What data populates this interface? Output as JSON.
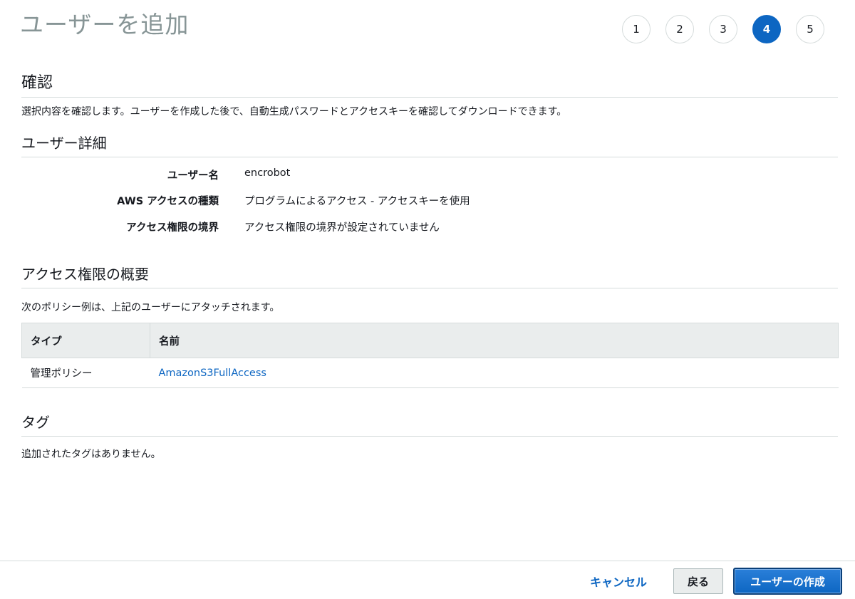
{
  "page": {
    "title": "ユーザーを追加"
  },
  "steps": [
    {
      "label": "1",
      "active": false
    },
    {
      "label": "2",
      "active": false
    },
    {
      "label": "3",
      "active": false
    },
    {
      "label": "4",
      "active": true
    },
    {
      "label": "5",
      "active": false
    }
  ],
  "review": {
    "heading": "確認",
    "description": "選択内容を確認します。ユーザーを作成した後で、自動生成パスワードとアクセスキーを確認してダウンロードできます。"
  },
  "user_details": {
    "heading": "ユーザー詳細",
    "rows": [
      {
        "label": "ユーザー名",
        "value": "encrobot"
      },
      {
        "label": "AWS アクセスの種類",
        "value": "プログラムによるアクセス - アクセスキーを使用"
      },
      {
        "label": "アクセス権限の境界",
        "value": "アクセス権限の境界が設定されていません"
      }
    ]
  },
  "permissions": {
    "heading": "アクセス権限の概要",
    "description": "次のポリシー例は、上記のユーザーにアタッチされます。",
    "columns": [
      "タイプ",
      "名前"
    ],
    "rows": [
      {
        "type": "管理ポリシー",
        "name": "AmazonS3FullAccess"
      }
    ]
  },
  "tags": {
    "heading": "タグ",
    "description": "追加されたタグはありません。"
  },
  "footer": {
    "cancel_label": "キャンセル",
    "back_label": "戻る",
    "create_label": "ユーザーの作成"
  },
  "colors": {
    "accent": "#0d66c2",
    "title_gray": "#879596",
    "table_header_bg": "#eaeded"
  }
}
